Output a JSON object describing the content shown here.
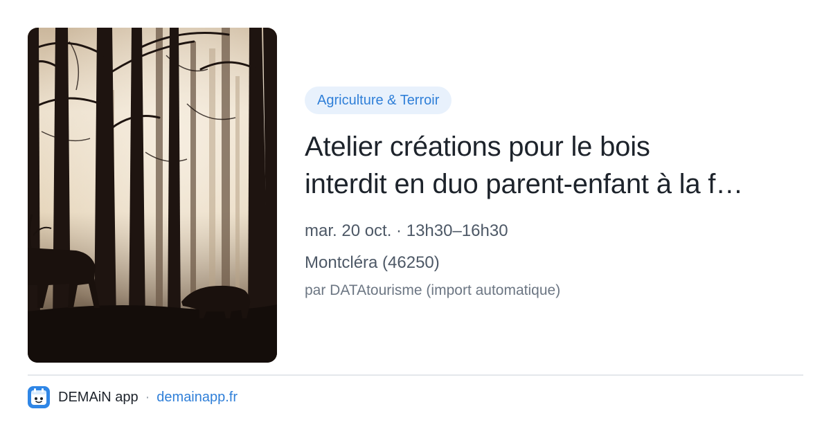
{
  "event": {
    "category": "Agriculture & Terroir",
    "title_line1": "Atelier créations pour le bois",
    "title_line2": "interdit en duo parent-enfant à la f…",
    "when": "mar. 20 oct. · 13h30–16h30",
    "where": "Montcléra (46250)",
    "source": "par DATAtourisme (import automatique)",
    "image": "misty forest with deer and wild boar silhouettes"
  },
  "footer": {
    "app_name": "DEMAiN app",
    "separator": "·",
    "site": "demainapp.fr",
    "icon": "demain-app-icon"
  },
  "colors": {
    "accent": "#2f7fd8",
    "tag_background": "#e8f1fc",
    "title": "#1d232b",
    "meta": "#4d5866"
  }
}
